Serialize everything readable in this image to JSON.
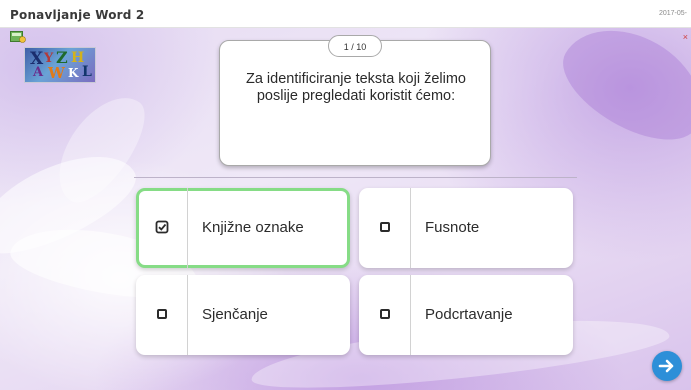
{
  "header": {
    "title": "Ponavljanje Word 2",
    "date": "2017-05-"
  },
  "quiz": {
    "counter": "1 / 10",
    "question": "Za identificiranje teksta koji želimo poslije pregledati koristit ćemo:",
    "answers": [
      {
        "label": "Knjižne oznake",
        "selected": true
      },
      {
        "label": "Fusnote",
        "selected": false
      },
      {
        "label": "Sjenčanje",
        "selected": false
      },
      {
        "label": "Podcrtavanje",
        "selected": false
      }
    ]
  },
  "icons": {
    "quiz": "quiz-icon",
    "logo": "crossword-logo",
    "next": "arrow-right-icon",
    "checked": "checked-box-icon",
    "unchecked": "checkbox-icon"
  },
  "colors": {
    "selected_border": "#86dc86",
    "next_button": "#2d8fd8",
    "background": "#e7dcf3"
  }
}
